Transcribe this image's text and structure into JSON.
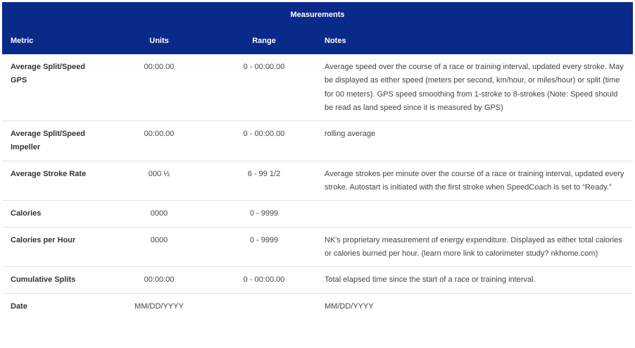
{
  "table": {
    "title": "Measurements",
    "headers": {
      "metric": "Metric",
      "units": "Units",
      "range": "Range",
      "notes": "Notes"
    },
    "rows": [
      {
        "metric": "Average Split/Speed GPS",
        "units": "00:00.00",
        "range": "0 - 00:00.00",
        "notes": "Average speed over the course of a race or training interval, updated every stroke. May be displayed as either speed (meters per second, km/hour, or miles/hour) or split (time for 00 meters). GPS speed smoothing from 1-stroke to 8-strokes (Note: Speed should be read as land speed since it is measured by GPS)"
      },
      {
        "metric": "Average Split/Speed Impeller",
        "units": "00:00.00",
        "range": "0 - 00:00.00",
        "notes": "rolling average"
      },
      {
        "metric": "Average Stroke Rate",
        "units": "000 ½",
        "range": "6 - 99 1/2",
        "notes": "Average strokes per minute over the course of a race or training interval, updated every stroke. Autostart is initiated with the first stroke when SpeedCoach is set to “Ready.”"
      },
      {
        "metric": "Calories",
        "units": "0000",
        "range": "0 - 9999",
        "notes": ""
      },
      {
        "metric": "Calories per Hour",
        "units": "0000",
        "range": "0 - 9999",
        "notes": "NK's proprietary measurement of energy expenditure. Displayed as either total calories or calories burned per hour. (learn more link to calorimeter study? nkhome.com)"
      },
      {
        "metric": "Cumulative Splits",
        "units": "00:00:00",
        "range": "0 - 00:00.00",
        "notes": "Total elapsed time since the start of a race or training interval."
      },
      {
        "metric": "Date",
        "units": "MM/DD/YYYY",
        "range": "",
        "notes": "MM/DD/YYYY"
      }
    ]
  }
}
